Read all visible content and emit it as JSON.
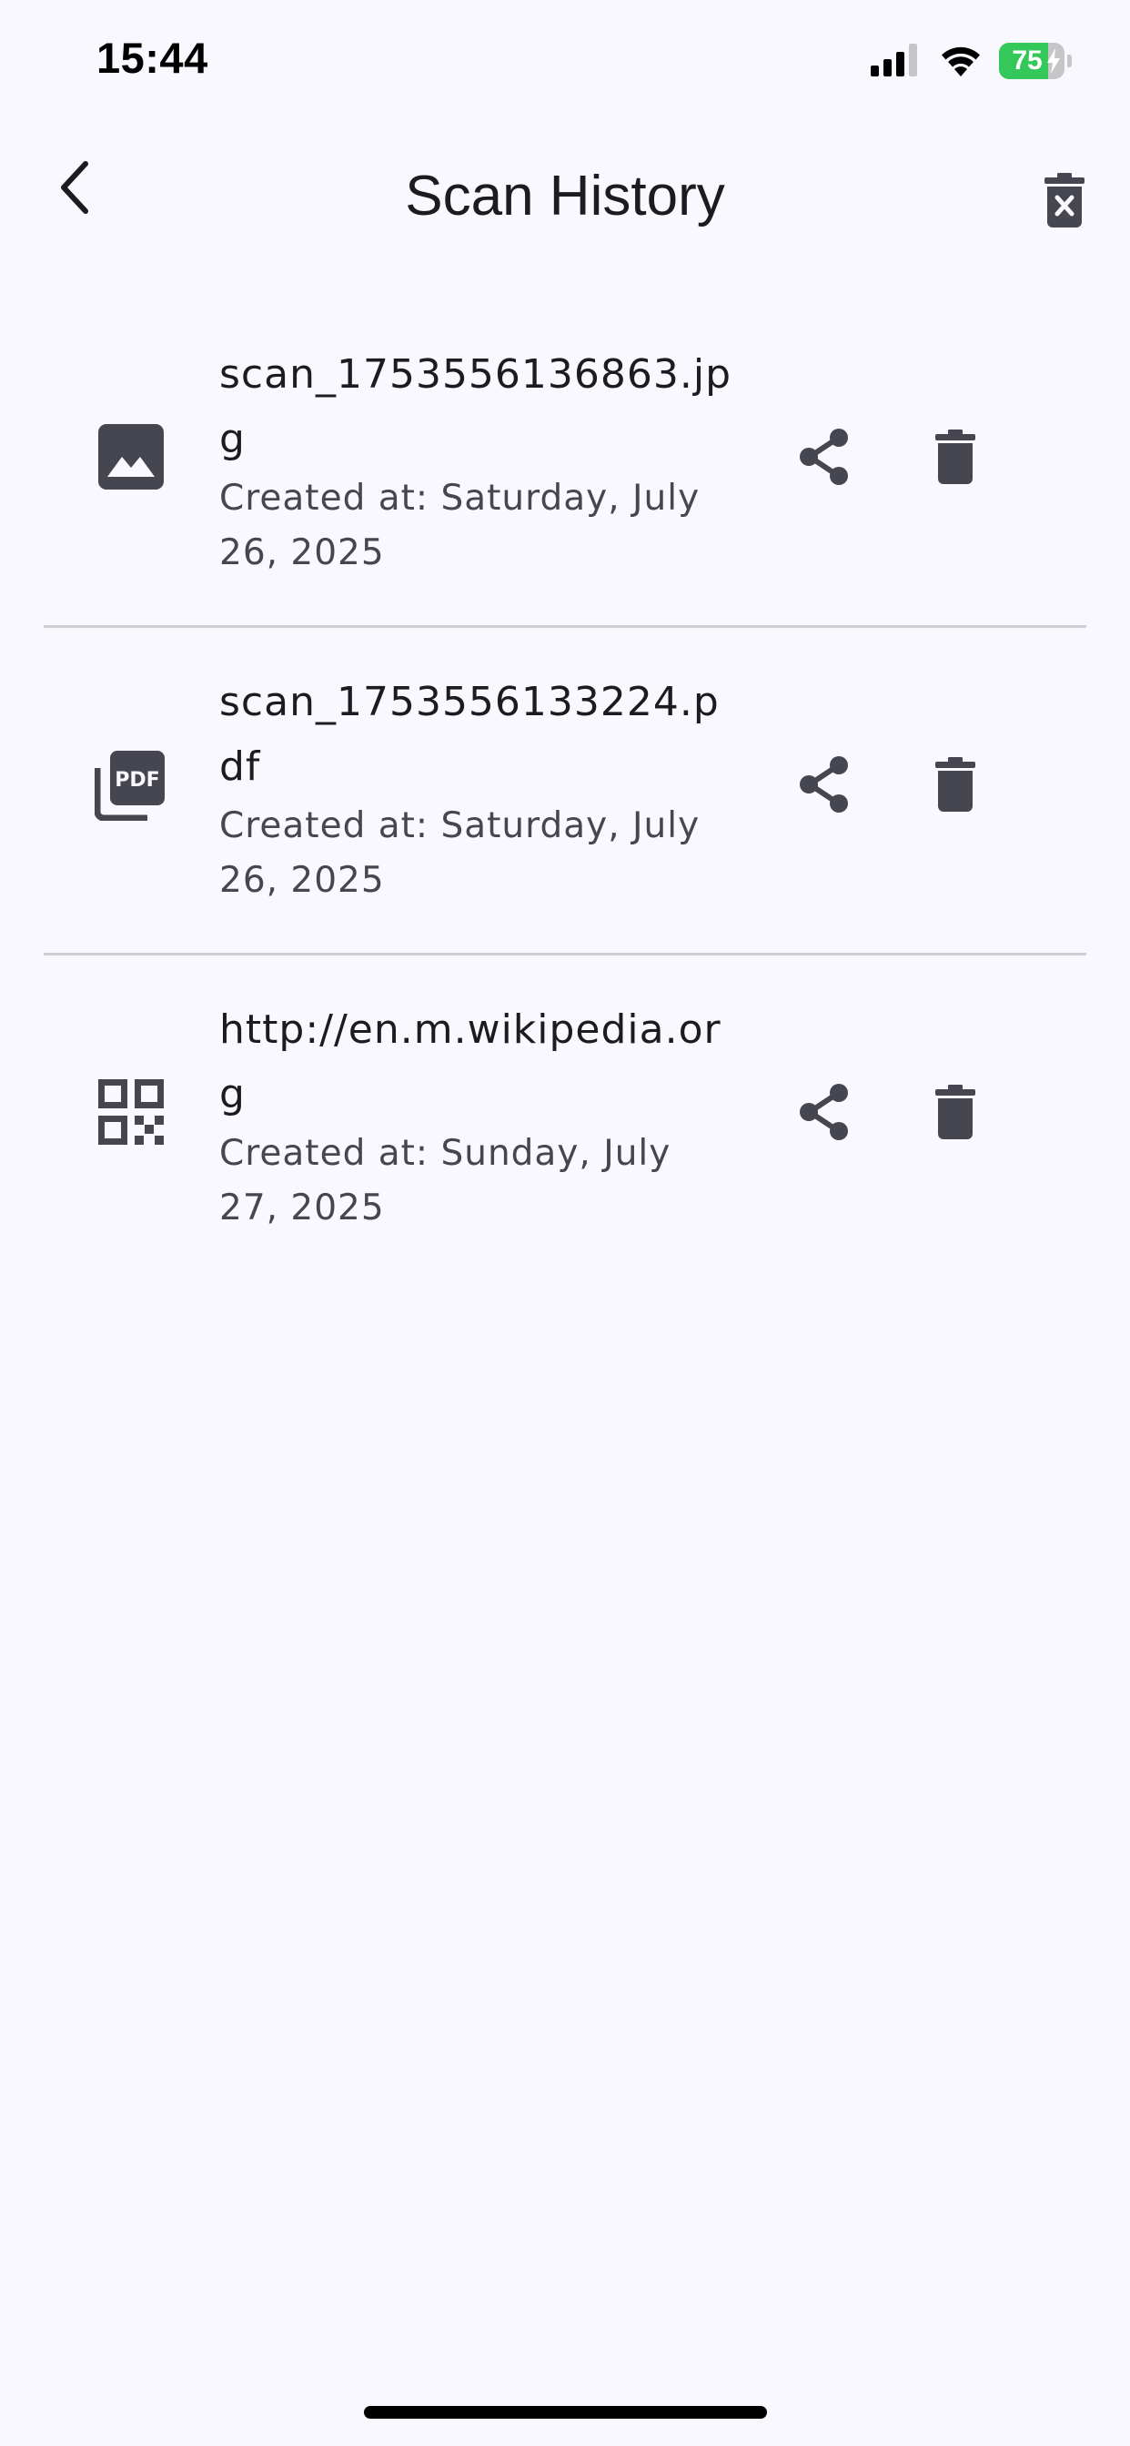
{
  "status_bar": {
    "time": "15:44",
    "battery_percent": "75",
    "battery_level": 0.75,
    "signal_icon": "cellular-signal-icon",
    "wifi_icon": "wifi-icon",
    "charging_icon": "charging-bolt-icon"
  },
  "app_bar": {
    "title": "Scan History",
    "back_icon": "chevron-left-icon",
    "clear_all_icon": "delete-forever-icon"
  },
  "colors": {
    "background": "#f8f8fe",
    "icon": "#45464f",
    "title_text": "#1c1b1f",
    "subtitle_text": "#49454f",
    "divider": "#cfced3",
    "battery_green": "#34c759"
  },
  "history": {
    "items": [
      {
        "title": "scan_1753556136863.jpg",
        "subtitle": "Created at: Saturday, July 26, 2025",
        "type_icon": "image-icon",
        "share_icon": "share-icon",
        "delete_icon": "trash-icon"
      },
      {
        "title": "scan_1753556133224.pdf",
        "subtitle": "Created at: Saturday, July 26, 2025",
        "type_icon": "pdf-icon",
        "share_icon": "share-icon",
        "delete_icon": "trash-icon"
      },
      {
        "title": "http://en.m.wikipedia.org",
        "subtitle": "Created at: Sunday, July 27, 2025",
        "type_icon": "qr-code-icon",
        "share_icon": "share-icon",
        "delete_icon": "trash-icon"
      }
    ]
  }
}
